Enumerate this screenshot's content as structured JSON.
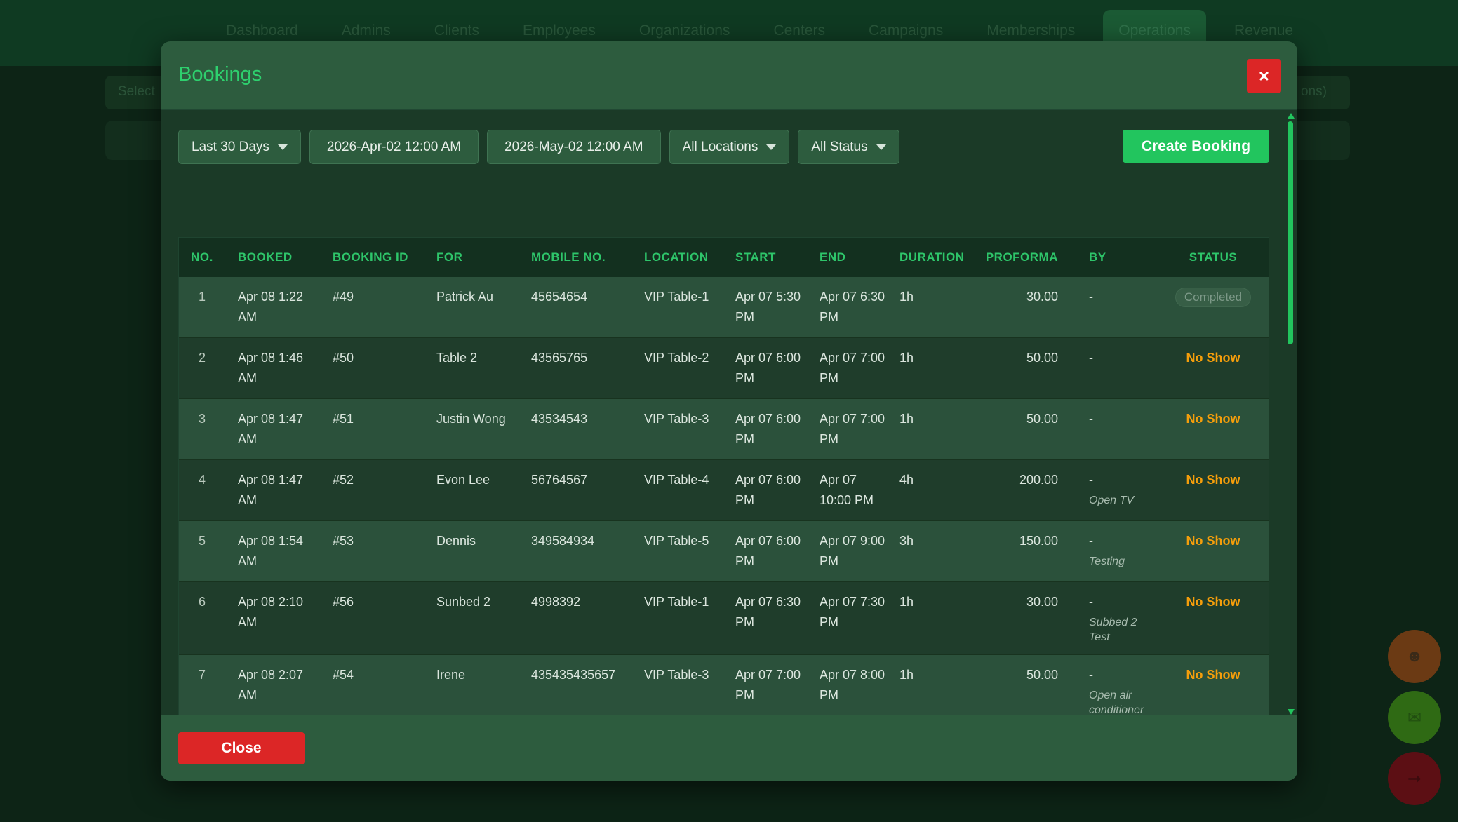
{
  "background": {
    "nav_items": [
      "Dashboard",
      "Admins",
      "Clients",
      "Employees",
      "Organizations",
      "Centers",
      "Campaigns",
      "Memberships",
      "Operations",
      "Revenue"
    ],
    "active_nav": "Operations",
    "select_left": "Select",
    "select_right": "ons)"
  },
  "modal": {
    "title": "Bookings",
    "close_x": "×",
    "close_label": "Close"
  },
  "toolbar": {
    "range": "Last 30 Days",
    "date_from": "2026-Apr-02 12:00 AM",
    "date_to": "2026-May-02 12:00 AM",
    "location": "All Locations",
    "status": "All Status",
    "create_label": "Create Booking"
  },
  "table": {
    "columns": [
      "NO.",
      "BOOKED",
      "BOOKING ID",
      "FOR",
      "MOBILE NO.",
      "LOCATION",
      "START",
      "END",
      "DURATION",
      "PROFORMA",
      "BY",
      "STATUS"
    ],
    "rows": [
      {
        "no": "1",
        "booked": "Apr 08 1:22 AM",
        "id": "#49",
        "for": "Patrick Au",
        "mobile": "45654654",
        "location": "VIP Table-1",
        "start": "Apr 07 5:30 PM",
        "end": "Apr 07 6:30 PM",
        "duration": "1h",
        "proforma": "30.00",
        "by": "-",
        "note": "",
        "status": "Completed"
      },
      {
        "no": "2",
        "booked": "Apr 08 1:46 AM",
        "id": "#50",
        "for": "Table 2",
        "mobile": "43565765",
        "location": "VIP Table-2",
        "start": "Apr 07 6:00 PM",
        "end": "Apr 07 7:00 PM",
        "duration": "1h",
        "proforma": "50.00",
        "by": "-",
        "note": "",
        "status": "No Show"
      },
      {
        "no": "3",
        "booked": "Apr 08 1:47 AM",
        "id": "#51",
        "for": "Justin Wong",
        "mobile": "43534543",
        "location": "VIP Table-3",
        "start": "Apr 07 6:00 PM",
        "end": "Apr 07 7:00 PM",
        "duration": "1h",
        "proforma": "50.00",
        "by": "-",
        "note": "",
        "status": "No Show"
      },
      {
        "no": "4",
        "booked": "Apr 08 1:47 AM",
        "id": "#52",
        "for": "Evon Lee",
        "mobile": "56764567",
        "location": "VIP Table-4",
        "start": "Apr 07 6:00 PM",
        "end": "Apr 07 10:00 PM",
        "duration": "4h",
        "proforma": "200.00",
        "by": "-",
        "note": "Open TV",
        "status": "No Show"
      },
      {
        "no": "5",
        "booked": "Apr 08 1:54 AM",
        "id": "#53",
        "for": "Dennis",
        "mobile": "349584934",
        "location": "VIP Table-5",
        "start": "Apr 07 6:00 PM",
        "end": "Apr 07 9:00 PM",
        "duration": "3h",
        "proforma": "150.00",
        "by": "-",
        "note": "Testing",
        "status": "No Show"
      },
      {
        "no": "6",
        "booked": "Apr 08 2:10 AM",
        "id": "#56",
        "for": "Sunbed 2",
        "mobile": "4998392",
        "location": "VIP Table-1",
        "start": "Apr 07 6:30 PM",
        "end": "Apr 07 7:30 PM",
        "duration": "1h",
        "proforma": "30.00",
        "by": "-",
        "note": "Subbed 2 Test",
        "status": "No Show"
      },
      {
        "no": "7",
        "booked": "Apr 08 2:07 AM",
        "id": "#54",
        "for": "Irene",
        "mobile": "435435435657",
        "location": "VIP Table-3",
        "start": "Apr 07 7:00 PM",
        "end": "Apr 07 8:00 PM",
        "duration": "1h",
        "proforma": "50.00",
        "by": "-",
        "note": "Open air conditioner",
        "status": "No Show"
      }
    ]
  },
  "colors": {
    "accent": "#22c55e",
    "danger": "#dc2626",
    "no_show": "#f59e0b",
    "modal_bg": "#2d5c3e"
  }
}
